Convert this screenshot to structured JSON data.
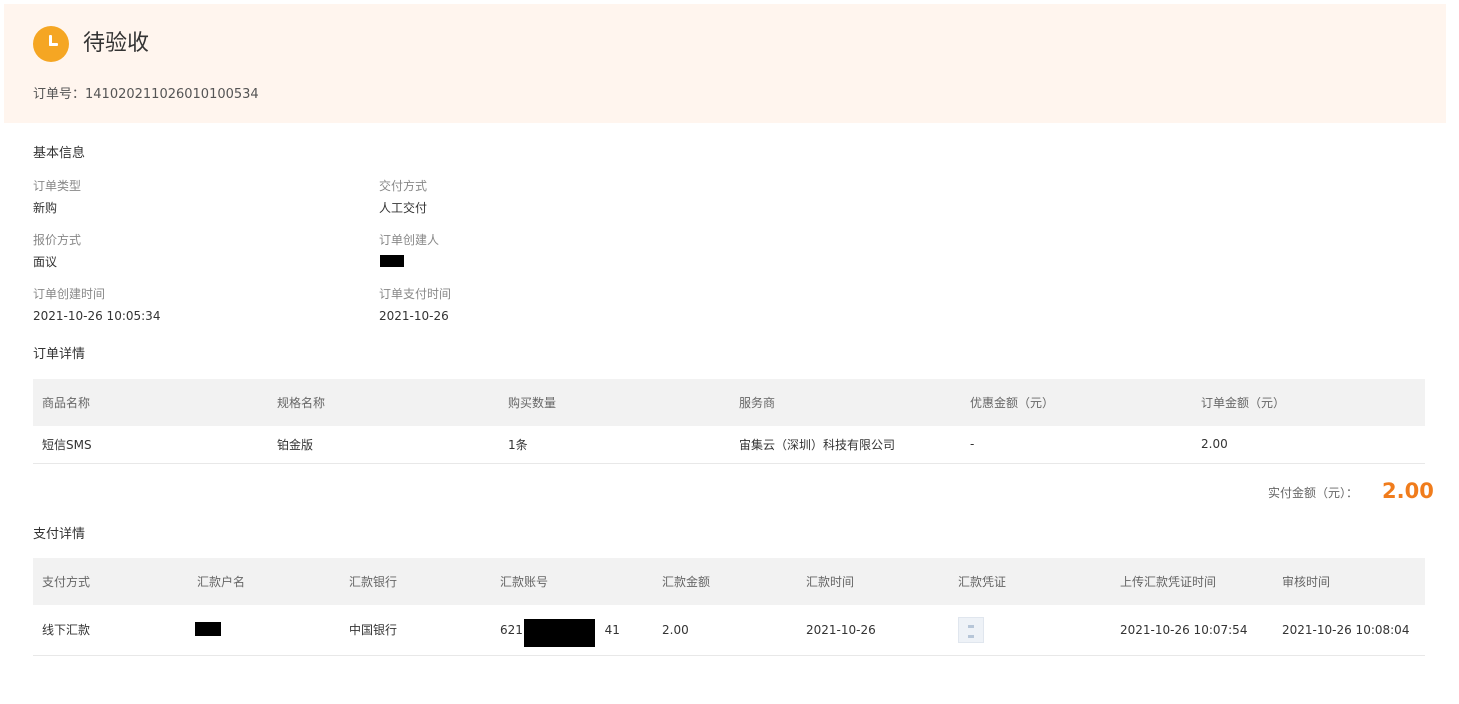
{
  "status": {
    "title": "待验收",
    "order_no": "订单号：141020211026010100534",
    "icon": "clock-icon",
    "accent": "#f5a623"
  },
  "basic_info": {
    "title": "基本信息",
    "order_type_label": "订单类型",
    "order_type_value": "新购",
    "delivery_label": "交付方式",
    "delivery_value": "人工交付",
    "quote_label": "报价方式",
    "quote_value": "面议",
    "creator_label": "订单创建人",
    "created_time_label": "订单创建时间",
    "created_time_value": "2021-10-26 10:05:34",
    "pay_time_label": "订单支付时间",
    "pay_time_value": "2021-10-26"
  },
  "order_detail": {
    "title": "订单详情",
    "headers": [
      "商品名称",
      "规格名称",
      "购买数量",
      "服务商",
      "优惠金额（元）",
      "订单金额（元）"
    ],
    "row": [
      "短信SMS",
      "铂金版",
      "1条",
      "宙集云（深圳）科技有限公司",
      "-",
      "2.00"
    ]
  },
  "total": {
    "label": "实付金额（元）：",
    "value": "2.00",
    "color": "#f07c1c"
  },
  "payment_detail": {
    "title": "支付详情",
    "headers": [
      "支付方式",
      "汇款户名",
      "汇款银行",
      "汇款账号",
      "汇款金额",
      "汇款时间",
      "汇款凭证",
      "上传汇款凭证时间",
      "审核时间"
    ],
    "row": {
      "method": "线下汇款",
      "bank": "中国银行",
      "account_prefix": "621",
      "account_suffix": "41",
      "amount": "2.00",
      "remit_time": "2021-10-26",
      "upload_time": "2021-10-26 10:07:54",
      "audit_time": "2021-10-26 10:08:04"
    }
  }
}
